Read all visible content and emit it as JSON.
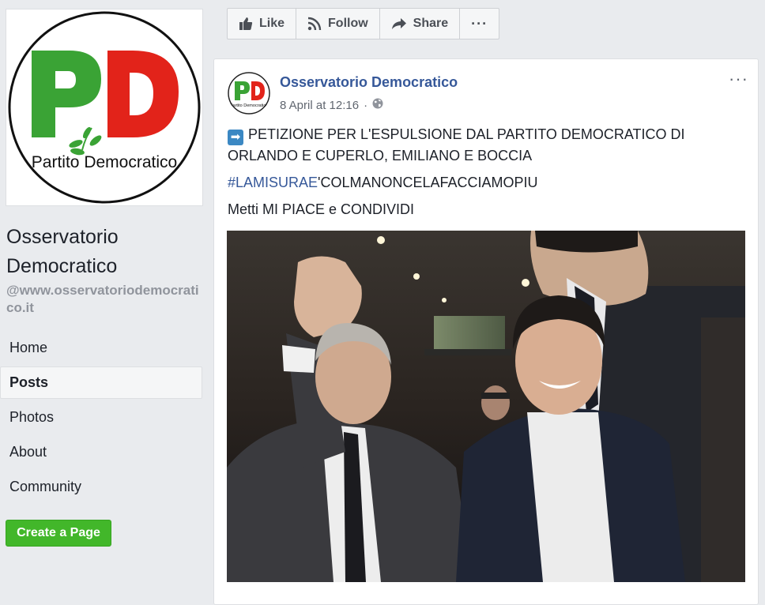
{
  "sidebar": {
    "logo_text": "Partito Democratico",
    "page_name": "Osservatorio Democratico",
    "page_handle": "@www.osservatoriodemocratico.it",
    "nav": [
      {
        "label": "Home"
      },
      {
        "label": "Posts"
      },
      {
        "label": "Photos"
      },
      {
        "label": "About"
      },
      {
        "label": "Community"
      }
    ],
    "create_page_label": "Create a Page"
  },
  "action_bar": {
    "like_label": "Like",
    "follow_label": "Follow",
    "share_label": "Share",
    "more_label": "···"
  },
  "post": {
    "author": "Osservatorio Democratico",
    "timestamp": "8 April at 12:16",
    "separator": "·",
    "line1": "PETIZIONE PER L'ESPULSIONE DAL PARTITO DEMOCRATICO DI ORLANDO E CUPERLO, EMILIANO E BOCCIA",
    "hashtag": "#LAMISURAE",
    "hashtag_rest": "'COLMANONCELAFACCIAMOPIU",
    "line3": "Metti MI PIACE e CONDIVIDI",
    "more_label": "···",
    "avatar_text": "Partito Democratico"
  },
  "colors": {
    "link": "#365899",
    "create_button": "#42b72a",
    "logo_green": "#3aa335",
    "logo_red": "#e2231a"
  }
}
